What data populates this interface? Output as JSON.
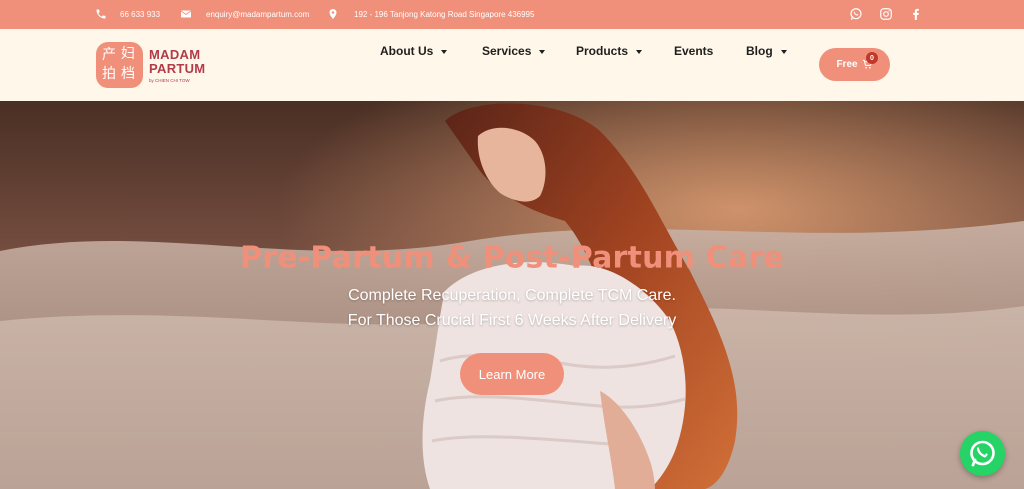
{
  "topbar": {
    "phone": "66 633 933",
    "email": "enquiry@madampartum.com",
    "address": "192 - 196 Tanjong Katong Road Singapore 436995",
    "icons": {
      "phone": "phone-icon",
      "email": "envelope-icon",
      "address": "map-pin-icon"
    },
    "social": [
      "whatsapp-icon",
      "instagram-icon",
      "facebook-icon"
    ]
  },
  "logo": {
    "chinese": [
      "产",
      "妇",
      "拍",
      "档"
    ],
    "line1": "MADAM",
    "line2": "PARTUM",
    "byline": "by CHIEN CHI TOW"
  },
  "nav": [
    {
      "label": "About Us",
      "dropdown": true
    },
    {
      "label": "Services",
      "dropdown": true
    },
    {
      "label": "Products",
      "dropdown": true
    },
    {
      "label": "Events",
      "dropdown": false
    },
    {
      "label": "Blog",
      "dropdown": true
    }
  ],
  "cart": {
    "label": "Free",
    "count": "0",
    "icon": "cart-icon"
  },
  "hero": {
    "title": "Pre-Partum & Post-Partum Care",
    "subtitle1": "Complete Recuperation, Complete TCM Care.",
    "subtitle2": "For Those Crucial First 6 Weeks After Delivery",
    "button": "Learn More"
  },
  "colors": {
    "accent": "#f0907a",
    "header_bg": "#fff8ea",
    "brand_text": "#b23b49",
    "whatsapp": "#25d366"
  }
}
